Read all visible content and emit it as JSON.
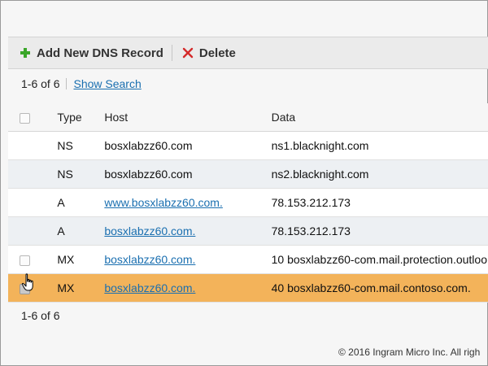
{
  "toolbar": {
    "add_label": "Add New DNS Record",
    "delete_label": "Delete"
  },
  "pager": {
    "range_text": "1-6 of 6",
    "show_search": "Show Search",
    "bottom_range_text": "1-6 of 6"
  },
  "table": {
    "columns": [
      "Type",
      "Host",
      "Data"
    ],
    "rows": [
      {
        "type": "NS",
        "host": "bosxlabzz60.com",
        "data": "ns1.blacknight.com",
        "host_link": false,
        "checkbox": false,
        "selected": false
      },
      {
        "type": "NS",
        "host": "bosxlabzz60.com",
        "data": "ns2.blacknight.com",
        "host_link": false,
        "checkbox": false,
        "selected": false
      },
      {
        "type": "A",
        "host": "www.bosxlabzz60.com.",
        "data": "78.153.212.173",
        "host_link": true,
        "checkbox": false,
        "selected": false
      },
      {
        "type": "A",
        "host": "bosxlabzz60.com.",
        "data": "78.153.212.173",
        "host_link": true,
        "checkbox": false,
        "selected": false
      },
      {
        "type": "MX",
        "host": "bosxlabzz60.com.",
        "data": "10 bosxlabzz60-com.mail.protection.outloo",
        "host_link": true,
        "checkbox": true,
        "selected": false
      },
      {
        "type": "MX",
        "host": "bosxlabzz60.com.",
        "data": "40 bosxlabzz60-com.mail.contoso.com.",
        "host_link": true,
        "checkbox": true,
        "selected": true
      }
    ]
  },
  "footer": {
    "copyright": "© 2016 Ingram Micro Inc. All righ"
  },
  "colors": {
    "selected_row": "#f3b35a",
    "alt_row": "#edf0f3",
    "link": "#1a6fb0",
    "add_icon": "#3aa629",
    "delete_icon": "#d42a2a"
  },
  "icons": {
    "add": "plus-icon",
    "delete": "x-icon",
    "cursor": "hand-pointer-icon"
  }
}
